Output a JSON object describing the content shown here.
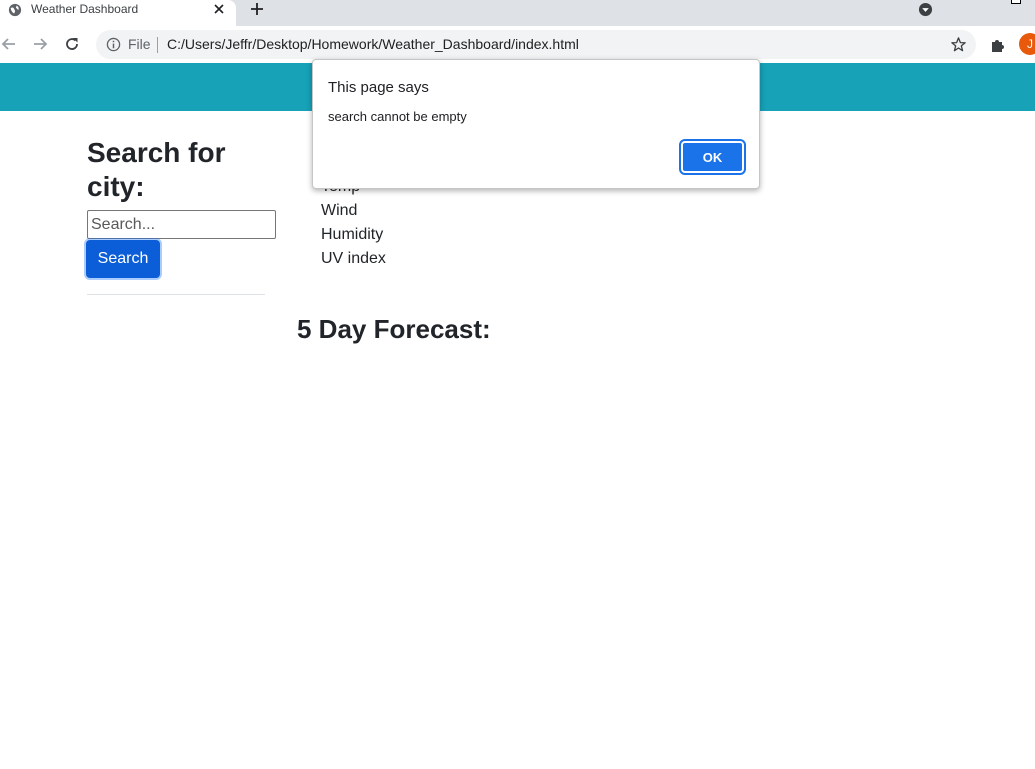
{
  "browser": {
    "tab": {
      "title": "Weather Dashboard"
    },
    "address": {
      "scheme_label": "File",
      "url": "C:/Users/Jeffr/Desktop/Homework/Weather_Dashboard/index.html"
    },
    "profile_initial": "J"
  },
  "sidebar": {
    "heading": "Search for city:",
    "search_placeholder": "Search...",
    "search_button_label": "Search"
  },
  "current_weather": {
    "items": [
      "Temp",
      "Wind",
      "Humidity",
      "UV index"
    ]
  },
  "forecast": {
    "heading": "5 Day Forecast:"
  },
  "alert": {
    "title": "This page says",
    "message": "search cannot be empty",
    "ok_label": "OK"
  },
  "colors": {
    "header": "#17a2b8",
    "primary_button": "#0d6efd",
    "dialog_button": "#1a73e8"
  }
}
